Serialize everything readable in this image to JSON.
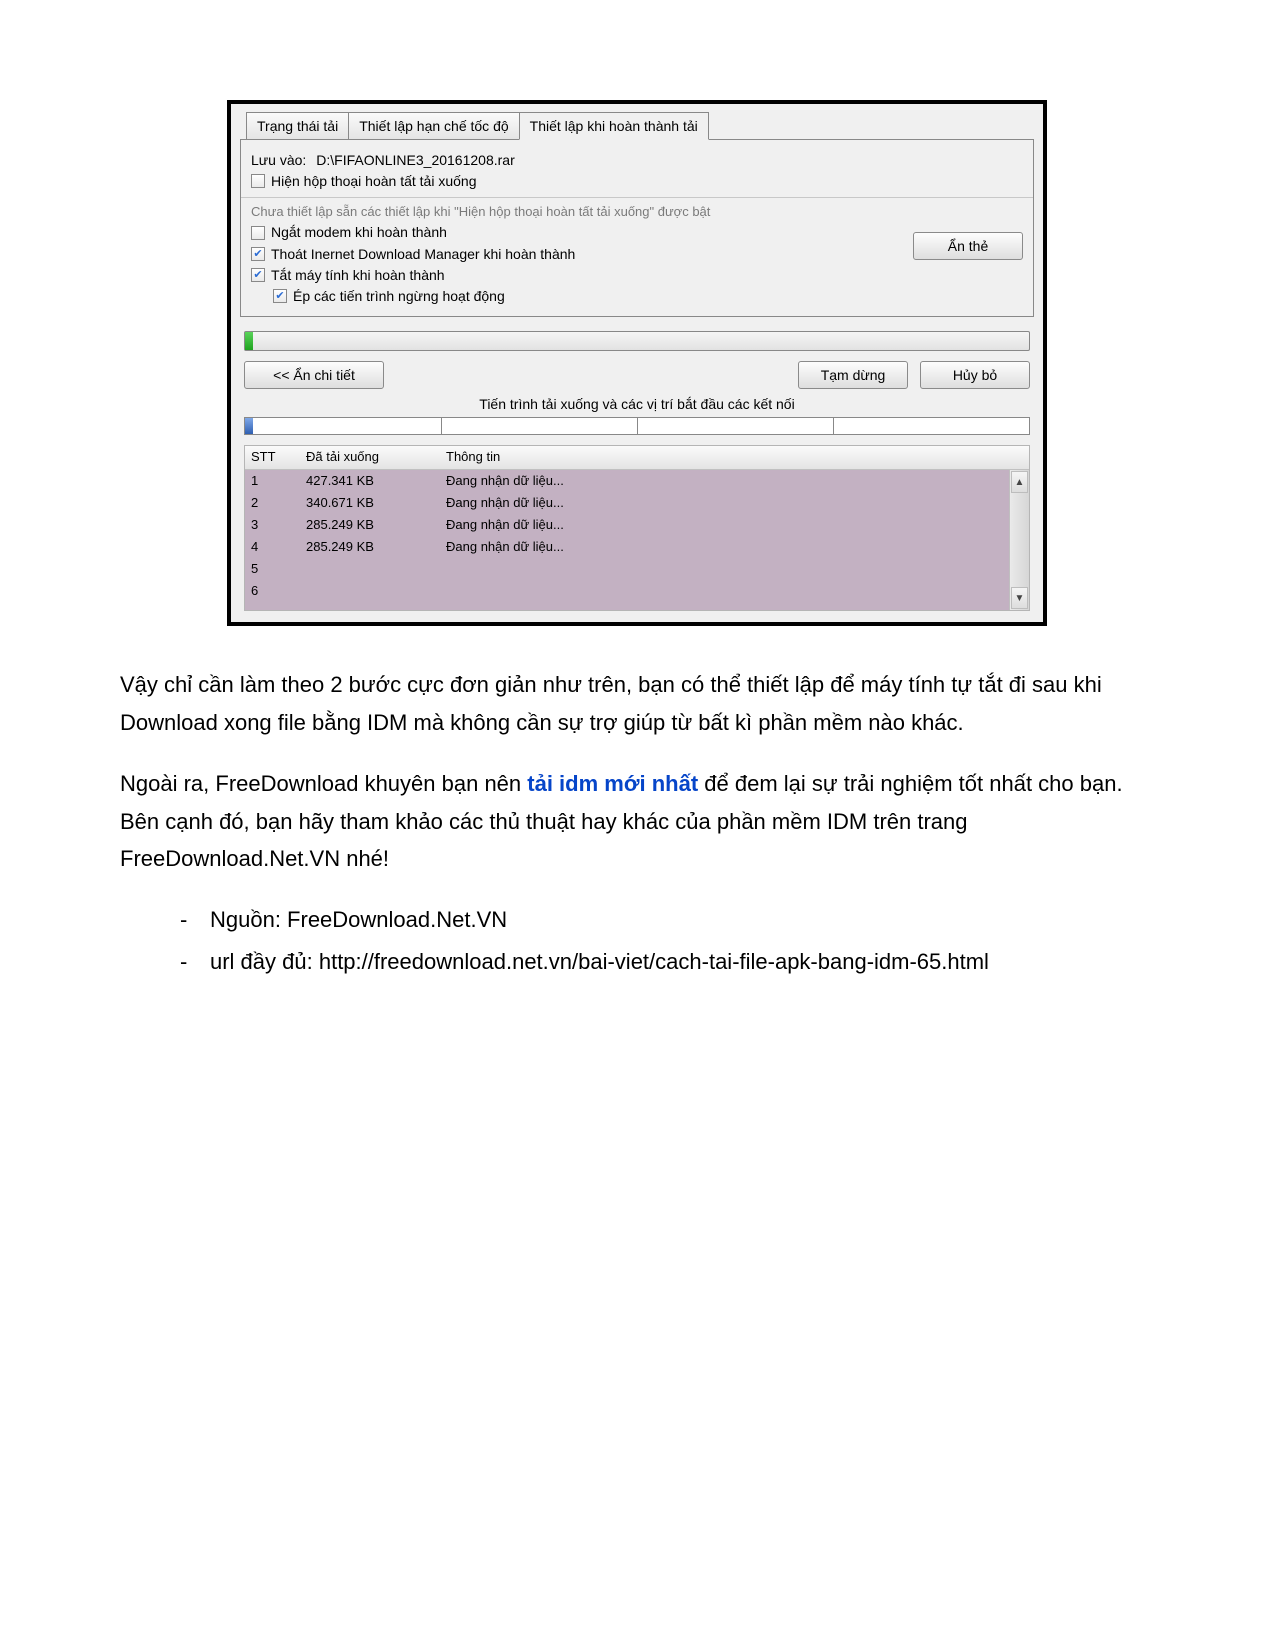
{
  "dialog": {
    "tabs": [
      {
        "label": "Trạng thái tải"
      },
      {
        "label": "Thiết lập hạn chế tốc độ"
      },
      {
        "label": "Thiết lập khi hoàn thành tải"
      }
    ],
    "save_to_label": "Lưu vào:",
    "save_to_path": "D:\\FIFAONLINE3_20161208.rar",
    "cb_show_complete": "Hiện hộp thoại hoàn tất tải xuống",
    "gray_note": "Chưa thiết lập sẵn các thiết lập khi  \"Hiện hộp thoại hoàn tất tải xuống\" được bật",
    "cb_disconnect_modem": "Ngắt modem khi hoàn thành",
    "cb_exit_idm": "Thoát Inernet Download Manager khi hoàn thành",
    "cb_shutdown": "Tắt máy tính khi hoàn thành",
    "cb_force": "Ép các tiến trình ngừng hoạt động",
    "btn_hide_tab": "Ẩn thẻ",
    "btn_hide_detail": "<< Ẩn chi tiết",
    "btn_pause": "Tạm dừng",
    "btn_cancel": "Hủy bỏ",
    "seg_caption": "Tiến trình tải xuống và các vị trí bắt đầu các kết nối",
    "table_headers": {
      "stt": "STT",
      "downloaded": "Đã tải xuống",
      "info": "Thông tin"
    },
    "rows": [
      {
        "n": "1",
        "size": "427.341 KB",
        "info": "Đang nhận dữ liệu..."
      },
      {
        "n": "2",
        "size": "340.671 KB",
        "info": "Đang nhận dữ liệu..."
      },
      {
        "n": "3",
        "size": "285.249 KB",
        "info": "Đang nhận dữ liệu..."
      },
      {
        "n": "4",
        "size": "285.249 KB",
        "info": "Đang nhận dữ liệu..."
      },
      {
        "n": "5",
        "size": "",
        "info": ""
      },
      {
        "n": "6",
        "size": "",
        "info": ""
      }
    ]
  },
  "article": {
    "p1": "Vậy chỉ cần làm theo 2 bước cực đơn giản như trên, bạn có thể thiết lập để máy tính tự tắt đi sau khi Download xong file bằng IDM mà không cần sự trợ giúp từ bất kì phần mềm nào khác.",
    "p2a": "Ngoài ra, FreeDownload khuyên bạn nên ",
    "p2_link": "tải idm mới nhất",
    "p2b": " để đem lại sự trải nghiệm tốt nhất cho bạn. Bên cạnh đó, bạn hãy tham khảo các thủ thuật hay khác của phần mềm IDM trên trang FreeDownload.Net.VN nhé!",
    "li1": "Nguồn: FreeDownload.Net.VN",
    "li2": "url đầy đủ: http://freedownload.net.vn/bai-viet/cach-tai-file-apk-bang-idm-65.html"
  }
}
